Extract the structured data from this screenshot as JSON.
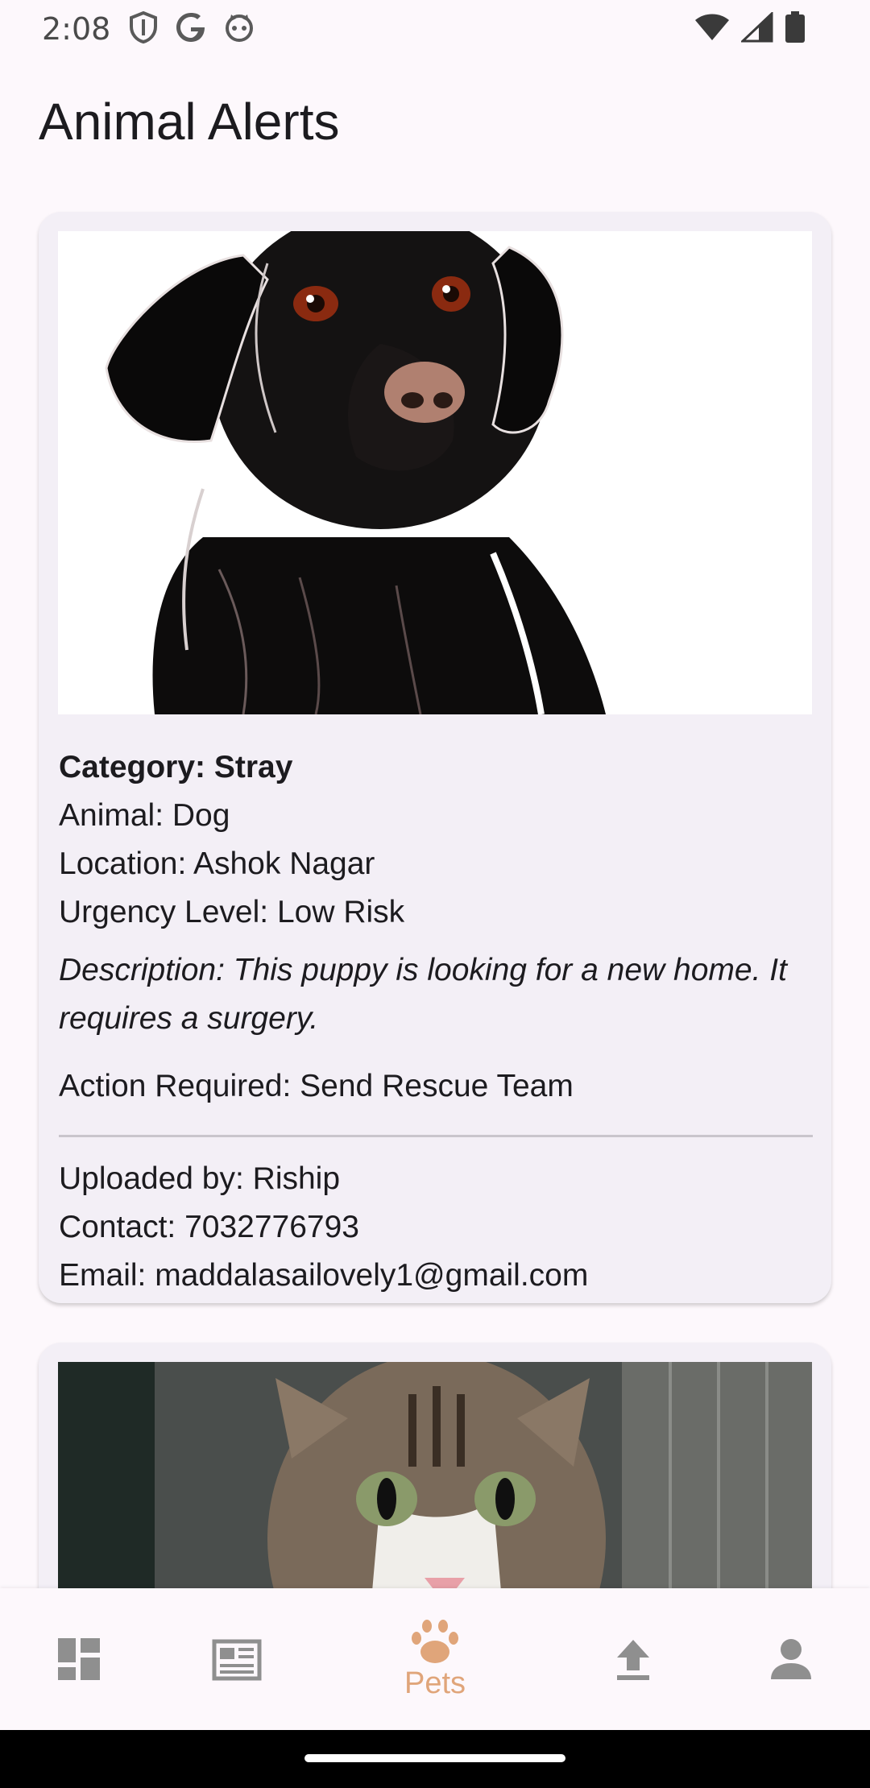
{
  "status_bar": {
    "time": "2:08",
    "left_icons": [
      "shield-icon",
      "google-icon",
      "cat-face-icon"
    ],
    "right_icons": [
      "wifi-icon",
      "cell-signal-icon",
      "battery-icon"
    ]
  },
  "page": {
    "title": "Animal Alerts"
  },
  "alerts": [
    {
      "image": "black-dog-illustration",
      "category": "Category: Stray",
      "animal": "Animal: Dog",
      "location": "Location: Ashok Nagar",
      "urgency": "Urgency Level: Low Risk",
      "description": "Description: This puppy is looking for a new home. It requires a surgery.",
      "action": "Action Required: Send Rescue Team",
      "uploaded_by": "Uploaded by: Riship",
      "contact": "Contact: 7032776793",
      "email": "Email: maddalasailovely1@gmail.com"
    },
    {
      "image": "tabby-kitten-photo"
    }
  ],
  "bottom_nav": {
    "items": [
      {
        "icon": "dashboard-icon",
        "label": ""
      },
      {
        "icon": "news-icon",
        "label": ""
      },
      {
        "icon": "paw-icon",
        "label": "Pets",
        "active": true
      },
      {
        "icon": "upload-icon",
        "label": ""
      },
      {
        "icon": "person-icon",
        "label": ""
      }
    ],
    "active_color": "#e0a57a",
    "inactive_color": "#8f8f8f"
  }
}
